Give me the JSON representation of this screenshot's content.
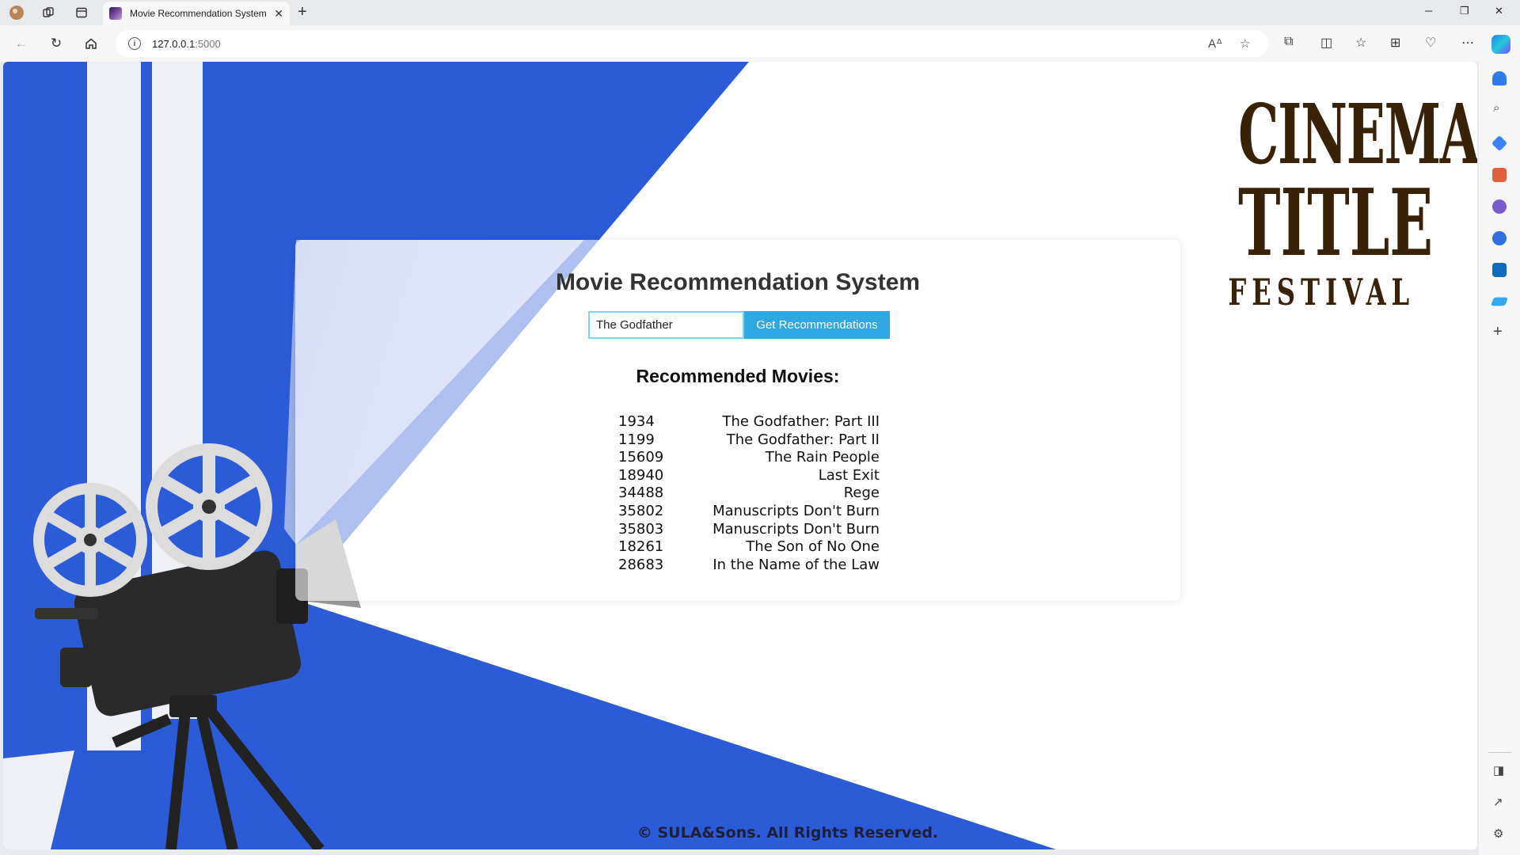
{
  "browser": {
    "tab_title": "Movie Recommendation System",
    "url_host": "127.0.0.1",
    "url_port": ":5000"
  },
  "page": {
    "title": "Movie Recommendation System",
    "search": {
      "value": "The Godfather"
    },
    "button_label": "Get Recommendations",
    "results_heading": "Recommended Movies:",
    "recommendations": [
      {
        "id": "1934",
        "title": "The Godfather: Part III"
      },
      {
        "id": "1199",
        "title": "The Godfather: Part II"
      },
      {
        "id": "15609",
        "title": "The Rain People"
      },
      {
        "id": "18940",
        "title": "Last Exit"
      },
      {
        "id": "34488",
        "title": "Rege"
      },
      {
        "id": "35802",
        "title": "Manuscripts Don't Burn"
      },
      {
        "id": "35803",
        "title": "Manuscripts Don't Burn"
      },
      {
        "id": "18261",
        "title": "The Son of No One"
      },
      {
        "id": "28683",
        "title": "In the Name of the Law"
      }
    ],
    "logo": {
      "line1": "CINEMA",
      "line2": "TITLE",
      "line3": "FESTIVAL"
    },
    "footer": "© SULA&Sons. All Rights Reserved."
  },
  "colors": {
    "accent_blue": "#2a5ad8",
    "button": "#30a6e3",
    "logo_brown": "#3a2208"
  }
}
